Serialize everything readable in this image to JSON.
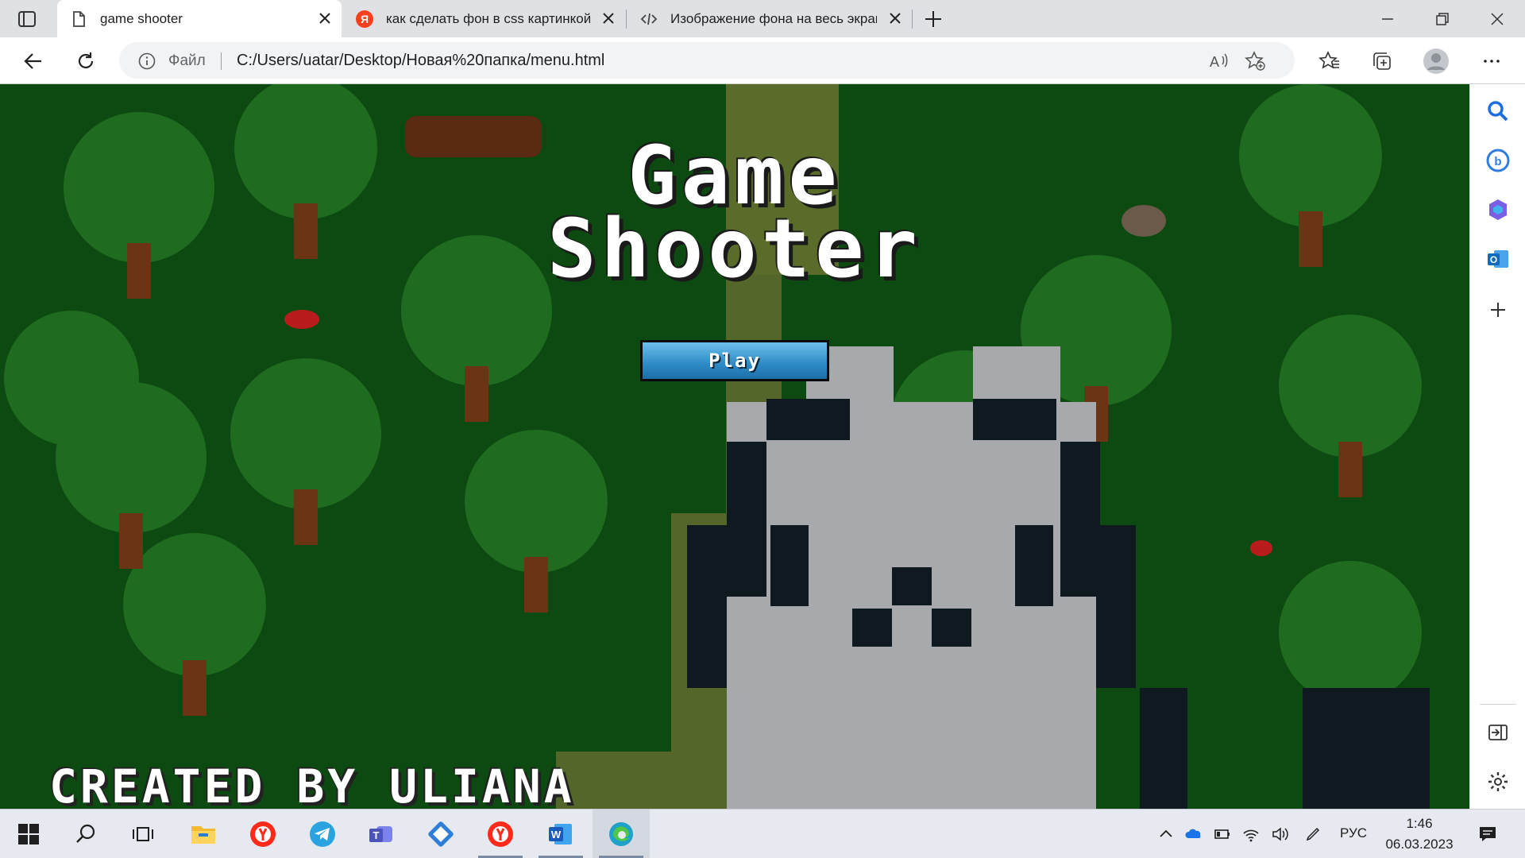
{
  "browser": {
    "tabs": [
      {
        "title": "game shooter",
        "icon": "page-icon",
        "active": true
      },
      {
        "title": "как сделать фон в css картинкой",
        "icon": "yandex-icon",
        "active": false
      },
      {
        "title": "Изображение фона на весь экран",
        "icon": "code-icon",
        "active": false
      }
    ],
    "address": {
      "scheme_label": "Файл",
      "url": "C:/Users/uatar/Desktop/Новая%20папка/menu.html"
    }
  },
  "page": {
    "title_line1": "Game",
    "title_line2": "Shooter",
    "play_label": "Play",
    "credits": "CREATED BY ULIANA",
    "colors": {
      "grass": "#0d4a12",
      "button": "#2d8ac6",
      "title": "#ffffff"
    }
  },
  "taskbar": {
    "language": "РУС",
    "time": "1:46",
    "date": "06.03.2023"
  }
}
